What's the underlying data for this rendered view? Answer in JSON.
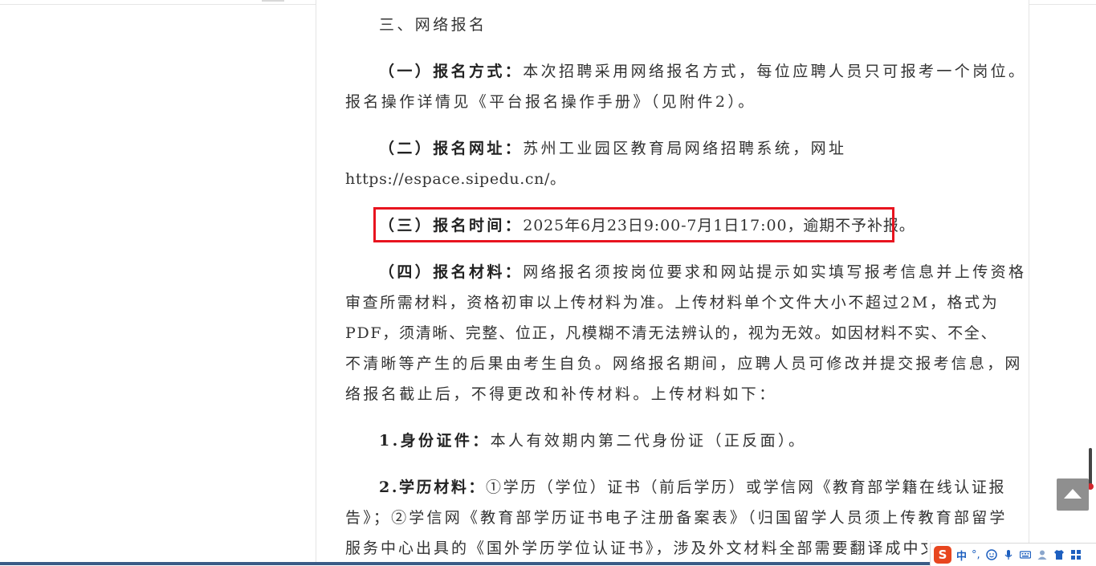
{
  "document": {
    "section_heading": "三、网络报名",
    "p1": {
      "label": "（一）报名方式：",
      "text_line1": "本次招聘采用网络报名方式，每位应聘人员只可报考一个岗位。",
      "text_line2": "报名操作详情见《平台报名操作手册》（见附件2）。"
    },
    "p2": {
      "label": "（二）报名网址：",
      "text_line1": "苏州工业园区教育局网络招聘系统，网址",
      "text_line2": "https://espace.sipedu.cn/。"
    },
    "p3": {
      "label": "（三）报名时间：",
      "text": "2025年6月23日9:00-7月1日17:00，逾期不予补报。"
    },
    "p4": {
      "label": "（四）报名材料：",
      "text_line1": "网络报名须按岗位要求和网站提示如实填写报考信息并上传资格",
      "text_line2": "审查所需材料，资格初审以上传材料为准。上传材料单个文件大小不超过2M，格式为",
      "text_line3": "PDF，须清晰、完整、位正，凡模糊不清无法辨认的，视为无效。如因材料不实、不全、",
      "text_line4": "不清晰等产生的后果由考生自负。网络报名期间，应聘人员可修改并提交报考信息，网",
      "text_line5": "络报名截止后，不得更改和补传材料。上传材料如下："
    },
    "item1": {
      "label": "1.身份证件：",
      "text": "本人有效期内第二代身份证（正反面）。"
    },
    "item2": {
      "label": "2.学历材料：",
      "text_line1": "①学历（学位）证书（前后学历）或学信网《教育部学籍在线认证报",
      "text_line2": "告》；②学信网《教育部学历证书电子注册备案表》（归国留学人员须上传教育部留学",
      "text_line3": "服务中心出具的《国外学历学位认证书》，涉及外文材料全部需要翻译成中文版本，去"
    }
  },
  "ime": {
    "logo": "S",
    "mode": "中",
    "punct": "°,"
  },
  "colors": {
    "highlight_border": "#e8141f",
    "text": "#333333",
    "back_to_top": "#8f8f8f"
  },
  "icons": [
    "back-to-top-icon",
    "thermometer-icon",
    "sogou-ime-icon",
    "emoji-icon",
    "microphone-icon",
    "keyboard-icon",
    "user-icon",
    "shirt-icon",
    "grid-icon"
  ]
}
